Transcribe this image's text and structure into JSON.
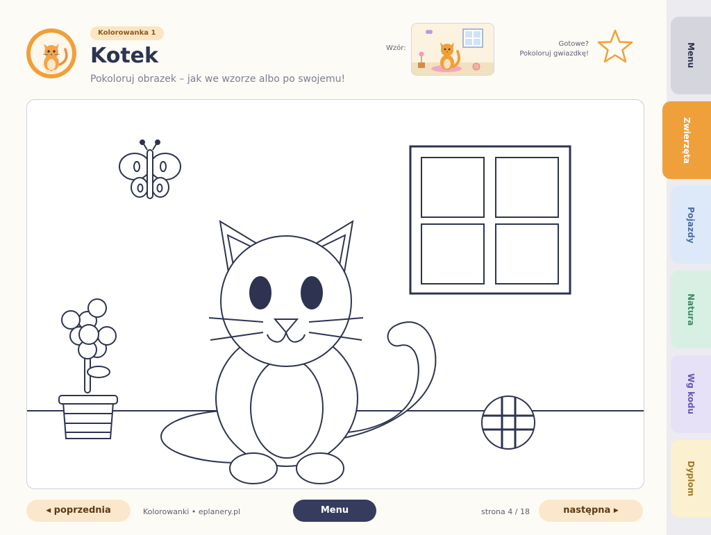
{
  "header": {
    "badge": "Kolorowanka 1",
    "title": "Kotek",
    "subtitle": "Pokoloruj obrazek – jak we wzorze albo po swojemu!",
    "pattern_label": "Wzór:",
    "ready_line1": "Gotowe?",
    "ready_line2": "Pokoloruj gwiazdkę!",
    "avatar_icon": "cat-icon",
    "star_icon": "star-icon"
  },
  "footer": {
    "prev_label": "poprzednia",
    "next_label": "następna",
    "menu_label": "Menu",
    "source": "Kolorowanki  •  eplanery.pl",
    "page": "strona 4 / 18"
  },
  "sidebar": {
    "tabs": [
      {
        "label": "Menu",
        "bg": "#d5d6dd",
        "color": "#2d3350",
        "active": false
      },
      {
        "label": "Zwierzęta",
        "bg": "#f0a03a",
        "color": "#ffffff",
        "active": true
      },
      {
        "label": "Pojazdy",
        "bg": "#dde9f8",
        "color": "#4a6fa5",
        "active": false
      },
      {
        "label": "Natura",
        "bg": "#d8f0e4",
        "color": "#3f8a63",
        "active": false
      },
      {
        "label": "Wg kodu",
        "bg": "#e6e1f7",
        "color": "#6a58b0",
        "active": false
      },
      {
        "label": "Dyplom",
        "bg": "#fbf0cf",
        "color": "#a07a2a",
        "active": false
      }
    ]
  },
  "colors": {
    "accent": "#f0a03a",
    "ink": "#2d3350",
    "menu_button": "#353c5e"
  }
}
